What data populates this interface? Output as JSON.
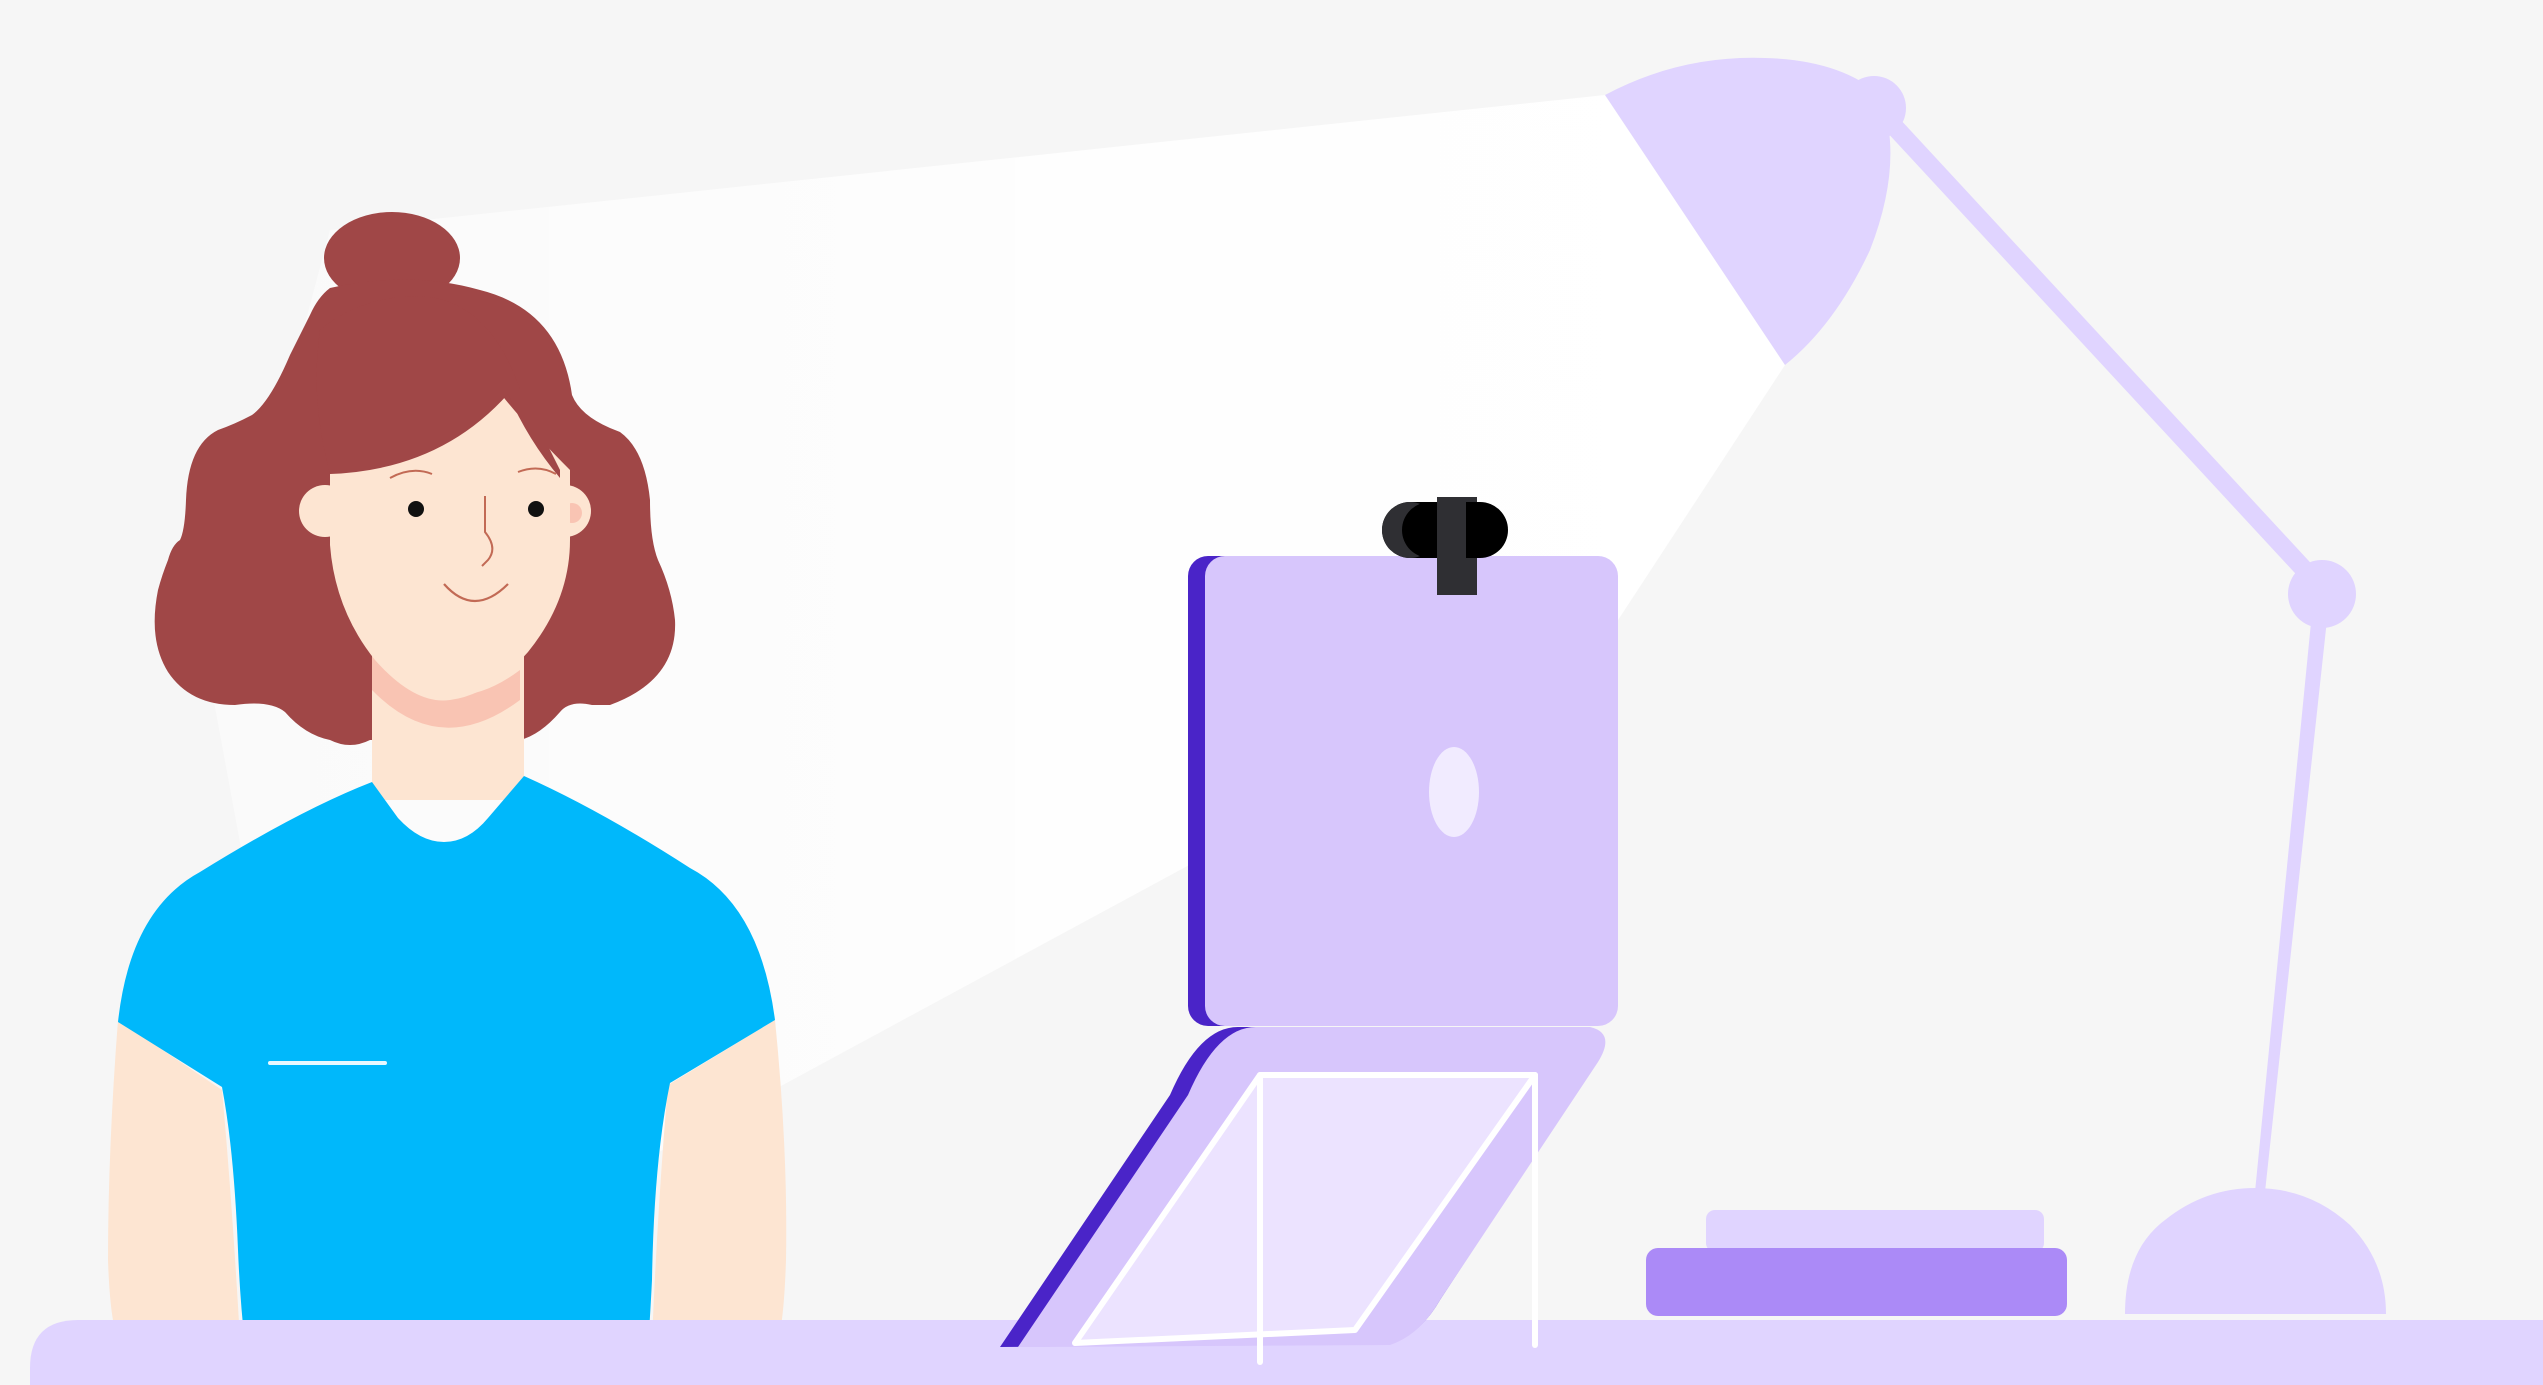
{
  "scene": {
    "subjects": [
      "woman-at-desk",
      "laptop-on-stand",
      "webcam-icon",
      "desk-lamp",
      "book-stack"
    ],
    "colors": {
      "background": "#f6f6f6",
      "desk": "#e0d4ff",
      "lamp": "#e0d4ff",
      "laptop_lid": "#d7c6fc",
      "laptop_edge": "#4a24c8",
      "book_top": "#e0d4ff",
      "book_bottom": "#ab8af7",
      "shirt": "#00b8fb",
      "hair": "#a04747",
      "skin": "#fde5d2",
      "webcam": "#000000"
    }
  }
}
